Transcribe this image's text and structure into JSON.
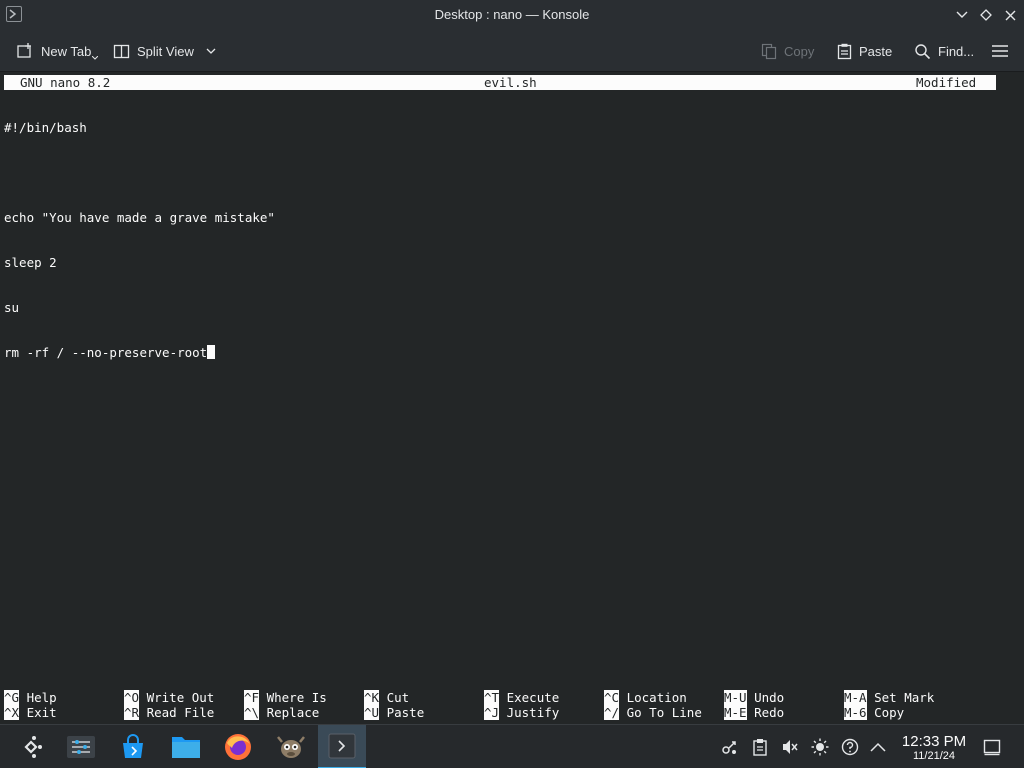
{
  "window": {
    "title": "Desktop : nano — Konsole"
  },
  "toolbar": {
    "new_tab": "New Tab",
    "split_view": "Split View",
    "copy": "Copy",
    "paste": "Paste",
    "find": "Find..."
  },
  "nano": {
    "version": "GNU nano 8.2",
    "filename": "evil.sh",
    "status": "Modified",
    "lines": [
      "#!/bin/bash",
      "",
      "echo \"You have made a grave mistake\"",
      "sleep 2",
      "su",
      "rm -rf / --no-preserve-root"
    ],
    "shortcuts": [
      {
        "key": "^G",
        "label": "Help"
      },
      {
        "key": "^X",
        "label": "Exit"
      },
      {
        "key": "^O",
        "label": "Write Out"
      },
      {
        "key": "^R",
        "label": "Read File"
      },
      {
        "key": "^F",
        "label": "Where Is"
      },
      {
        "key": "^\\",
        "label": "Replace"
      },
      {
        "key": "^K",
        "label": "Cut"
      },
      {
        "key": "^U",
        "label": "Paste"
      },
      {
        "key": "^T",
        "label": "Execute"
      },
      {
        "key": "^J",
        "label": "Justify"
      },
      {
        "key": "^C",
        "label": "Location"
      },
      {
        "key": "^/",
        "label": "Go To Line"
      },
      {
        "key": "M-U",
        "label": "Undo"
      },
      {
        "key": "M-E",
        "label": "Redo"
      },
      {
        "key": "M-A",
        "label": "Set Mark"
      },
      {
        "key": "M-6",
        "label": "Copy"
      }
    ]
  },
  "taskbar": {
    "apps": [
      "application-launcher-icon",
      "system-settings-icon",
      "discover-store-icon",
      "dolphin-files-icon",
      "firefox-icon",
      "gimp-icon",
      "konsole-icon"
    ],
    "clock": {
      "time": "12:33 PM",
      "date": "11/21/24"
    }
  },
  "colors": {
    "terminal_bg": "#232627",
    "chrome_bg": "#2a2e32",
    "accent": "#3daee9"
  }
}
